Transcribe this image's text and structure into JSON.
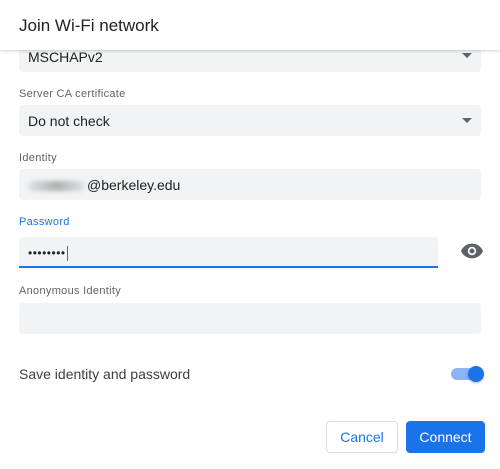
{
  "dialog": {
    "title": "Join Wi-Fi network"
  },
  "form": {
    "eap_phase2": {
      "value": "MSCHAPv2"
    },
    "server_ca": {
      "label": "Server CA certificate",
      "value": "Do not check"
    },
    "identity": {
      "label": "Identity",
      "value_suffix": "@berkeley.edu"
    },
    "password": {
      "label": "Password",
      "masked_value": "••••••••"
    },
    "anonymous_identity": {
      "label": "Anonymous Identity",
      "value": ""
    },
    "save_identity": {
      "label": "Save identity and password",
      "enabled": true
    }
  },
  "buttons": {
    "cancel": "Cancel",
    "connect": "Connect"
  },
  "colors": {
    "accent": "#1a73e8",
    "field_bg": "#f1f3f4",
    "toggle_track": "#8ab4f8"
  },
  "icons": {
    "dropdown": "caret-down-icon",
    "show_password": "eye-icon"
  }
}
